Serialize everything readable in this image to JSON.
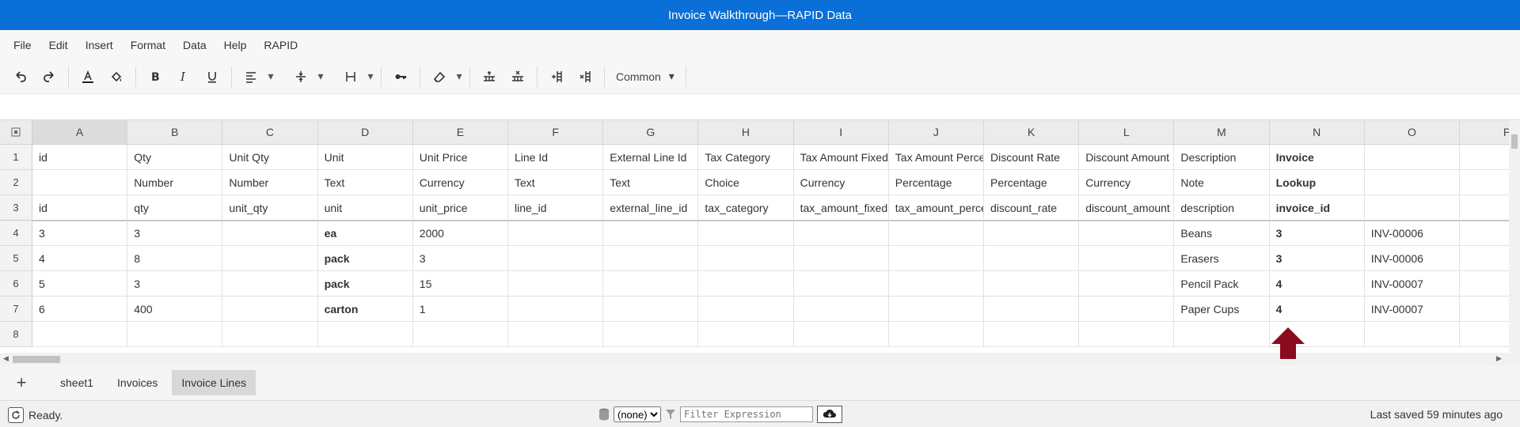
{
  "window": {
    "title": "Invoice Walkthrough—RAPID Data"
  },
  "menu": [
    "File",
    "Edit",
    "Insert",
    "Format",
    "Data",
    "Help",
    "RAPID"
  ],
  "toolbar": {
    "common_label": "Common"
  },
  "columns": [
    "A",
    "B",
    "C",
    "D",
    "E",
    "F",
    "G",
    "H",
    "I",
    "J",
    "K",
    "L",
    "M",
    "N",
    "O",
    "P"
  ],
  "rows": [
    {
      "num": "1",
      "cells": [
        "id",
        "Qty",
        "Unit Qty",
        "Unit",
        "Unit Price",
        "Line Id",
        "External Line Id",
        "Tax Category",
        "Tax Amount Fixed",
        "Tax Amount Percentage",
        "Discount Rate",
        "Discount Amount",
        "Description",
        "Invoice",
        "",
        ""
      ]
    },
    {
      "num": "2",
      "cells": [
        "",
        "Number",
        "Number",
        "Text",
        "Currency",
        "Text",
        "Text",
        "Choice",
        "Currency",
        "Percentage",
        "Percentage",
        "Currency",
        "Note",
        "Lookup",
        "",
        ""
      ]
    },
    {
      "num": "3",
      "cells": [
        "id",
        "qty",
        "unit_qty",
        "unit",
        "unit_price",
        "line_id",
        "external_line_id",
        "tax_category",
        "tax_amount_fixed",
        "tax_amount_percentage",
        "discount_rate",
        "discount_amount",
        "description",
        "invoice_id",
        "",
        ""
      ]
    },
    {
      "num": "4",
      "cells": [
        "3",
        "3",
        "",
        "ea",
        "2000",
        "",
        "",
        "",
        "",
        "",
        "",
        "",
        "Beans",
        "3",
        "INV-00006",
        ""
      ]
    },
    {
      "num": "5",
      "cells": [
        "4",
        "8",
        "",
        "pack",
        "3",
        "",
        "",
        "",
        "",
        "",
        "",
        "",
        "Erasers",
        "3",
        "INV-00006",
        ""
      ]
    },
    {
      "num": "6",
      "cells": [
        "5",
        "3",
        "",
        "pack",
        "15",
        "",
        "",
        "",
        "",
        "",
        "",
        "",
        "Pencil Pack",
        "4",
        "INV-00007",
        ""
      ]
    },
    {
      "num": "7",
      "cells": [
        "6",
        "400",
        "",
        "carton",
        "1",
        "",
        "",
        "",
        "",
        "",
        "",
        "",
        "Paper Cups",
        "4",
        "INV-00007",
        ""
      ]
    },
    {
      "num": "8",
      "cells": [
        "",
        "",
        "",
        "",
        "",
        "",
        "",
        "",
        "",
        "",
        "",
        "",
        "",
        "",
        "",
        ""
      ]
    }
  ],
  "tabs": [
    "sheet1",
    "Invoices",
    "Invoice Lines"
  ],
  "active_tab": "Invoice Lines",
  "status": {
    "ready": "Ready.",
    "source_selected": "(none)",
    "filter_placeholder": "Filter Expression",
    "last_saved": "Last saved 59 minutes ago"
  },
  "colors": {
    "titlebar": "#0a6fd6",
    "annotation_arrow": "#8b0a1e"
  }
}
